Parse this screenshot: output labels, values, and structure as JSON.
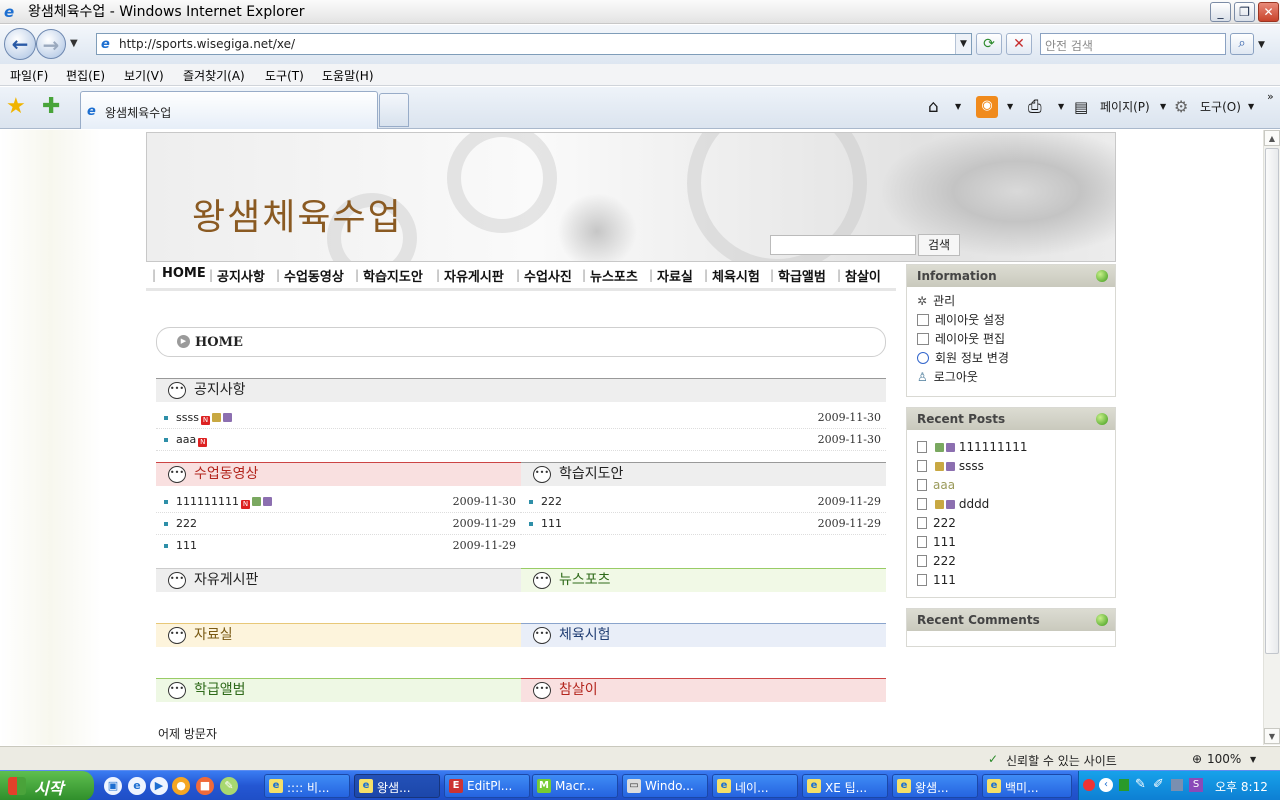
{
  "window": {
    "title": "왕샘체육수업 - Windows Internet Explorer",
    "min": "_",
    "max": "❐",
    "close": "✕"
  },
  "address": {
    "url": "http://sports.wisegiga.net/xe/",
    "search_placeholder": "안전 검색"
  },
  "menubar": [
    "파일(F)",
    "편집(E)",
    "보기(V)",
    "즐겨찾기(A)",
    "도구(T)",
    "도움말(H)"
  ],
  "tab": {
    "title": "왕샘체육수업"
  },
  "commandbar": {
    "page": "페이지(P)",
    "tools": "도구(O)"
  },
  "site": {
    "title": "왕샘체육수업",
    "search_button": "검색",
    "gnb": [
      "HOME",
      "공지사항",
      "수업동영상",
      "학습지도안",
      "자유게시판",
      "수업사진",
      "뉴스포츠",
      "자료실",
      "체육시험",
      "학급앨범",
      "참살이"
    ],
    "breadcrumb": "HOME",
    "sections": {
      "notice": {
        "title": "공지사항",
        "rows": [
          {
            "title": "ssss",
            "date": "2009-11-30"
          },
          {
            "title": "aaa",
            "date": "2009-11-30"
          }
        ]
      },
      "video": {
        "title": "수업동영상",
        "rows": [
          {
            "title": "111111111",
            "date": "2009-11-30"
          },
          {
            "title": "222",
            "date": "2009-11-29"
          },
          {
            "title": "111",
            "date": "2009-11-29"
          }
        ]
      },
      "plan": {
        "title": "학습지도안",
        "rows": [
          {
            "title": "222",
            "date": "2009-11-29"
          },
          {
            "title": "111",
            "date": "2009-11-29"
          }
        ]
      },
      "free": {
        "title": "자유게시판"
      },
      "newsports": {
        "title": "뉴스포츠"
      },
      "data": {
        "title": "자료실"
      },
      "exam": {
        "title": "체육시험"
      },
      "album": {
        "title": "학급앨범"
      },
      "wellbeing": {
        "title": "참살이"
      }
    },
    "visitors_label": "어제 방문자",
    "sidebar": {
      "info_title": "Information",
      "info_items": [
        "관리",
        "레이아웃 설정",
        "레이아웃 편집",
        "회원 정보 변경",
        "로그아웃"
      ],
      "recent_posts_title": "Recent Posts",
      "recent_posts": [
        "111111111",
        "ssss",
        "aaa",
        "dddd",
        "222",
        "111",
        "222",
        "111"
      ],
      "recent_comments_title": "Recent Comments"
    }
  },
  "status": {
    "zone": "신뢰할 수 있는 사이트",
    "zoom": "100%"
  },
  "taskbar": {
    "start": "시작",
    "tasks": [
      ":::: 비...",
      "왕샘...",
      "EditPl...",
      "Macr...",
      "Windo...",
      "네이...",
      "XE 팁...",
      "왕샘...",
      "백미..."
    ],
    "clock": "오후 8:12"
  }
}
